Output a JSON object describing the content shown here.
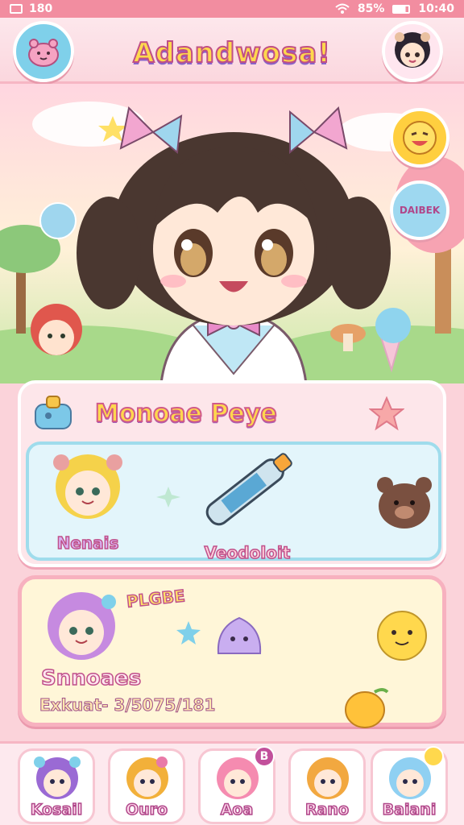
{
  "status_bar": {
    "left_icon": "sim-icon",
    "time_left": "180",
    "battery": "85%",
    "clock": "10:40"
  },
  "header": {
    "title": "Adandwosa!"
  },
  "hero": {
    "speech_bubble": "DAIBEK"
  },
  "panel": {
    "title": "Monoae Peye",
    "items": [
      {
        "label": "Nenais"
      },
      {
        "label": "Veodoloit"
      }
    ]
  },
  "card2": {
    "badge_text": "PLGBE",
    "name": "Snnoaes",
    "subline": "Exkuat- 3/5075/181"
  },
  "nav": {
    "items": [
      {
        "label": "Kosail",
        "badge": ""
      },
      {
        "label": "Ouro",
        "badge": ""
      },
      {
        "label": "Aoa",
        "badge": "B"
      },
      {
        "label": "Rano",
        "badge": ""
      },
      {
        "label": "Baiani",
        "badge": ""
      }
    ]
  },
  "colors": {
    "pink": "#f28da0",
    "accent_yellow": "#ffd84d",
    "outline_magenta": "#c04f86",
    "sky": "#7fd0ea"
  }
}
